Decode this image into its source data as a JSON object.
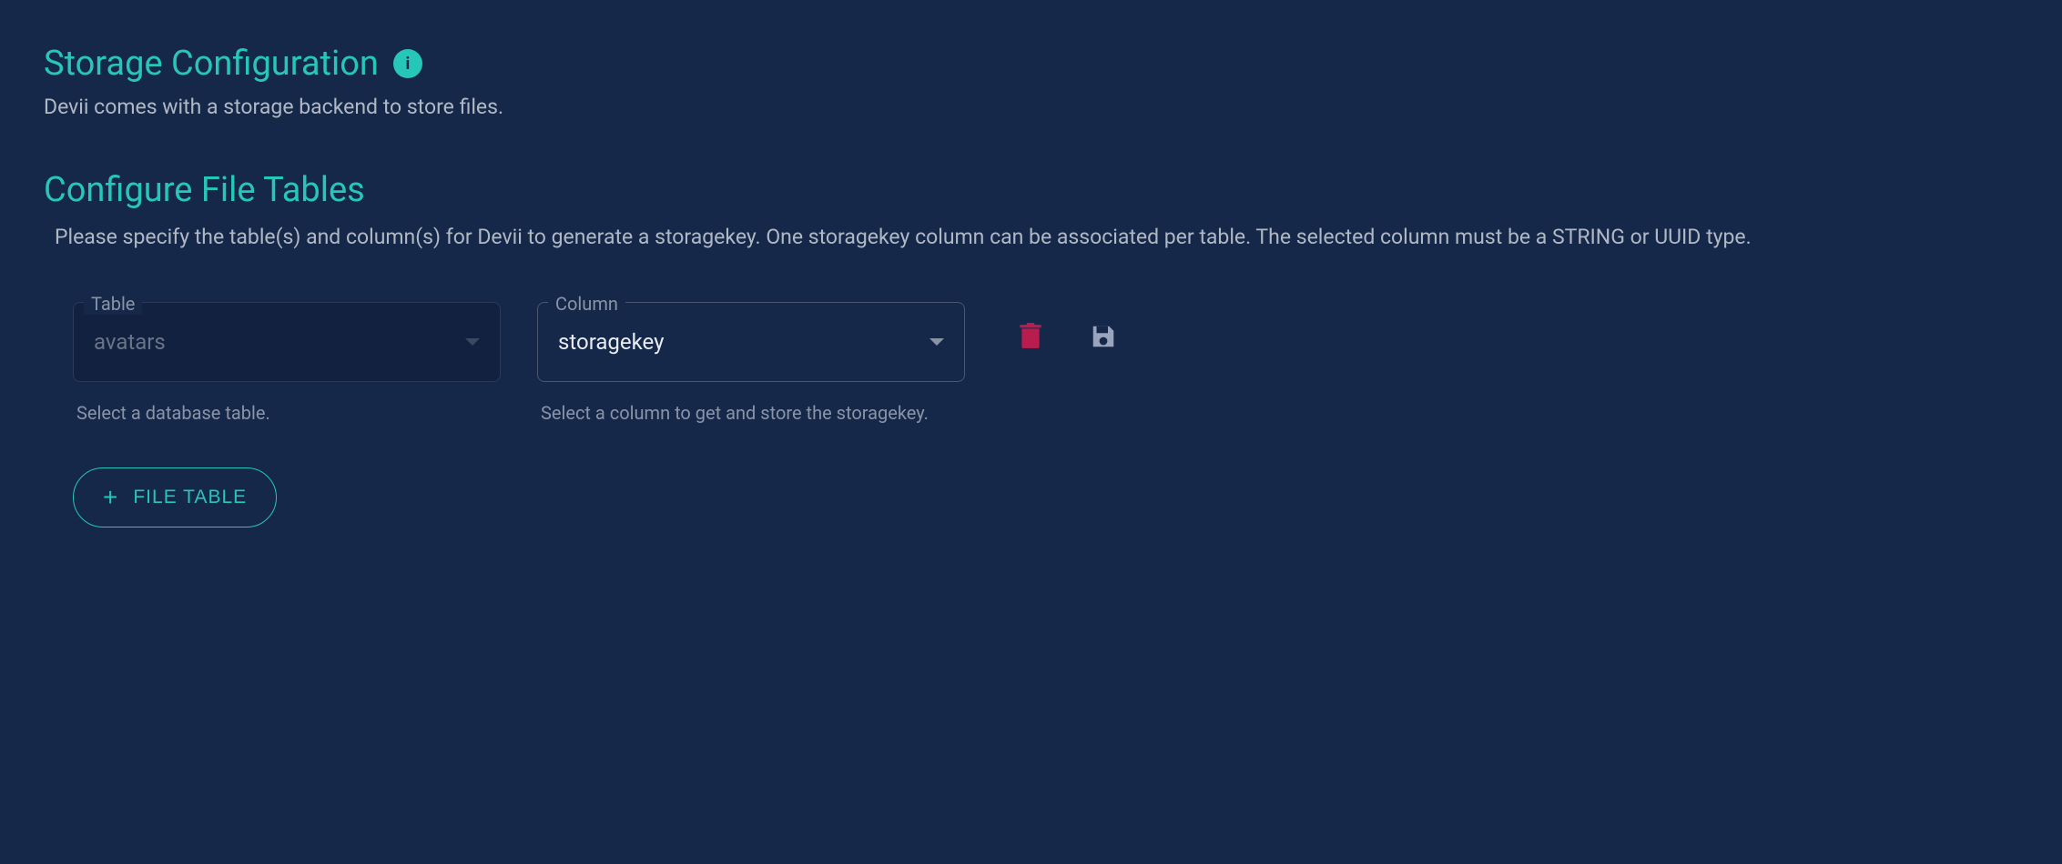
{
  "header": {
    "title": "Storage Configuration",
    "info_icon": "i",
    "description": "Devii comes with a storage backend to store files."
  },
  "section": {
    "title": "Configure File Tables",
    "description": "Please specify the table(s) and column(s) for Devii to generate a storagekey. One storagekey column can be associated per table. The selected column must be a STRING or UUID type."
  },
  "row": {
    "table": {
      "label": "Table",
      "value": "avatars",
      "hint": "Select a database table."
    },
    "column": {
      "label": "Column",
      "value": "storagekey",
      "hint": "Select a column to get and store the storagekey."
    }
  },
  "actions": {
    "add_button": "FILE TABLE"
  },
  "colors": {
    "accent": "#26c6b9",
    "danger": "#b91d4f",
    "muted": "#9aa4bd"
  }
}
